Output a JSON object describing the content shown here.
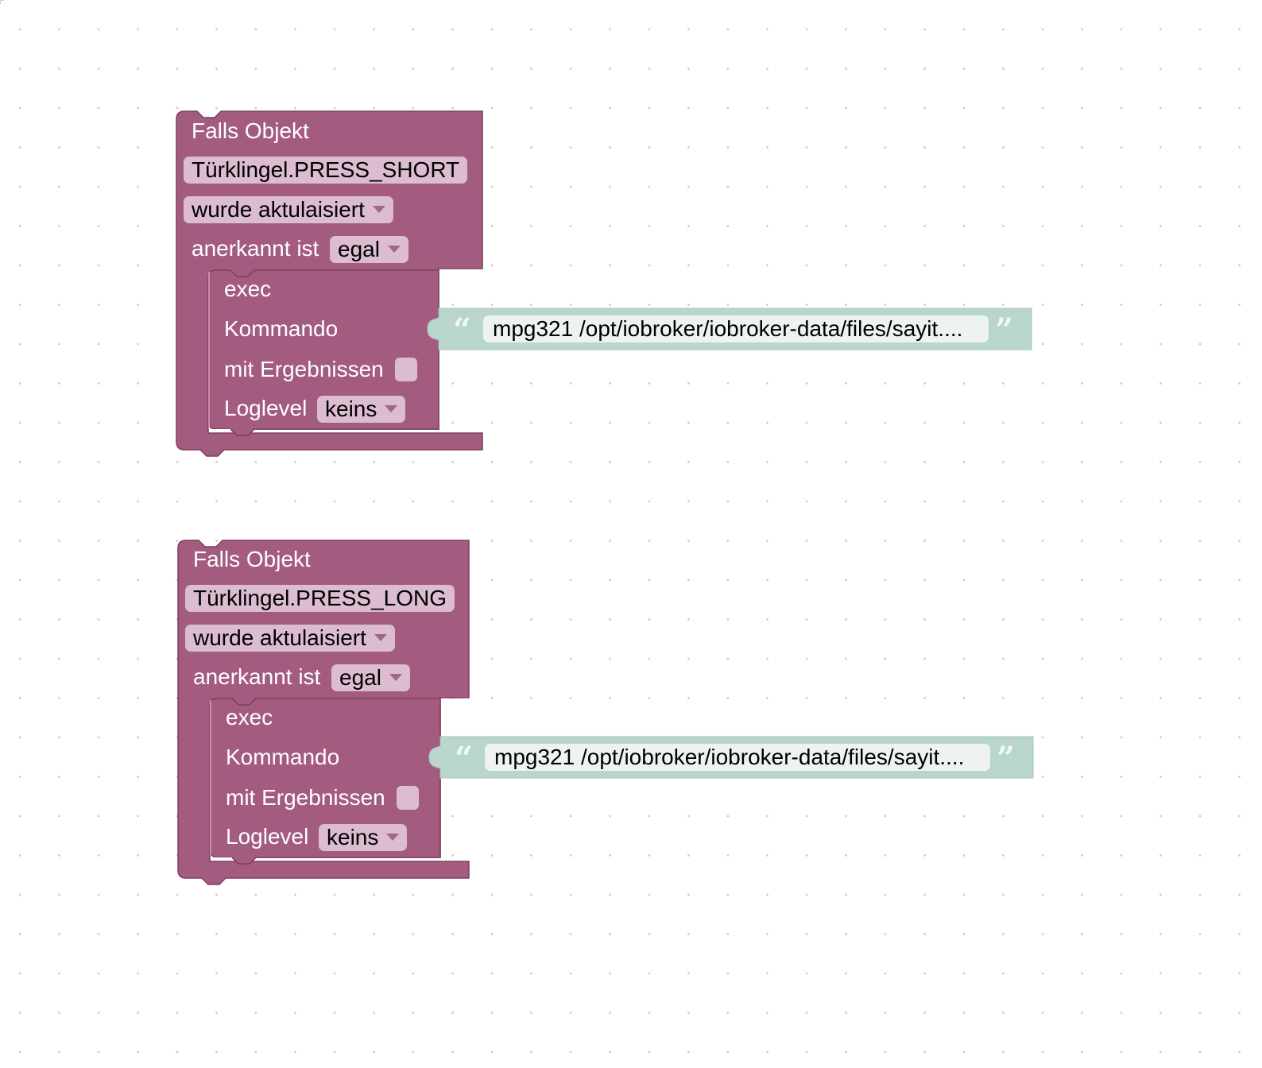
{
  "colors": {
    "event_block": "#a35c7f",
    "event_block_dark": "#7e3e5e",
    "string_block": "#b8d6cb",
    "field_bg": "#dcbcd0",
    "string_field_bg": "#eef3f1",
    "grid_dot": "#cdcdcd"
  },
  "blocks": [
    {
      "header": "Falls Objekt",
      "object_id": "Türklingel.PRESS_SHORT",
      "trigger": "wurde aktulaisiert",
      "ack_label": "anerkannt ist",
      "ack_value": "egal",
      "exec": {
        "title": "exec",
        "command_label": "Kommando",
        "results_label": "mit Ergebnissen",
        "results_checked": false,
        "loglevel_label": "Loglevel",
        "loglevel_value": "keins",
        "command_value": "mpg321 /opt/iobroker/iobroker-data/files/sayit...."
      }
    },
    {
      "header": "Falls Objekt",
      "object_id": "Türklingel.PRESS_LONG",
      "trigger": "wurde aktulaisiert",
      "ack_label": "anerkannt ist",
      "ack_value": "egal",
      "exec": {
        "title": "exec",
        "command_label": "Kommando",
        "results_label": "mit Ergebnissen",
        "results_checked": false,
        "loglevel_label": "Loglevel",
        "loglevel_value": "keins",
        "command_value": "mpg321 /opt/iobroker/iobroker-data/files/sayit...."
      }
    }
  ]
}
